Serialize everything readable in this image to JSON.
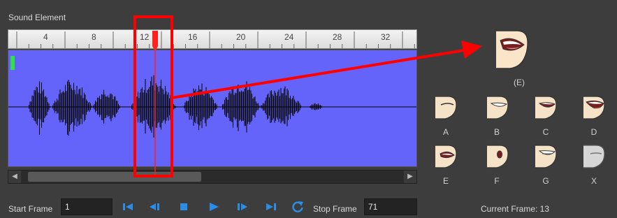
{
  "panel": {
    "title": "Sound Element"
  },
  "ruler": {
    "ticks": [
      "4",
      "8",
      "12",
      "16",
      "20",
      "24",
      "28",
      "32"
    ]
  },
  "controls": {
    "start_frame_label": "Start Frame",
    "start_frame_value": "1",
    "stop_frame_label": "Stop Frame",
    "stop_frame_value": "71",
    "buttons": [
      "first-frame",
      "previous-frame",
      "stop",
      "play",
      "next-frame",
      "last-frame",
      "loop"
    ]
  },
  "lipsync": {
    "preview_label": "(E)",
    "mouths": [
      "A",
      "B",
      "C",
      "D",
      "E",
      "F",
      "G",
      "X"
    ],
    "current_frame": "Current Frame: 13"
  },
  "colors": {
    "waveform_bg": "#6464fb",
    "highlight": "#ff0000",
    "accent": "#2b8ee6"
  }
}
